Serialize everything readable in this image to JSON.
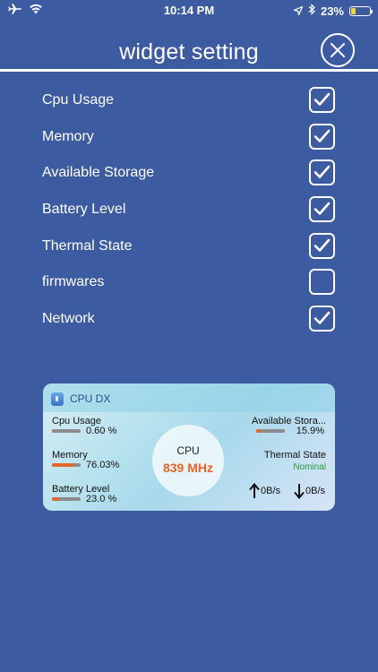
{
  "status_bar": {
    "time": "10:14 PM",
    "battery_text": "23%",
    "battery_level": 0.23,
    "battery_color": "#f5d33a"
  },
  "header": {
    "title": "widget setting"
  },
  "settings": [
    {
      "label": "Cpu Usage",
      "checked": true
    },
    {
      "label": "Memory",
      "checked": true
    },
    {
      "label": "Available Storage",
      "checked": true
    },
    {
      "label": "Battery Level",
      "checked": true
    },
    {
      "label": "Thermal State",
      "checked": true
    },
    {
      "label": "firmwares",
      "checked": false
    },
    {
      "label": "Network",
      "checked": true
    }
  ],
  "widget": {
    "app_name": "CPU DX",
    "cpu_usage": {
      "label": "Cpu Usage",
      "value": "0.60 %",
      "fraction": 0.006
    },
    "memory": {
      "label": "Memory",
      "value": "76.03%",
      "fraction": 0.7603
    },
    "battery": {
      "label": "Battery Level",
      "value": "23.0 %",
      "fraction": 0.23
    },
    "storage": {
      "label": "Available Stora...",
      "value": "15.9%",
      "fraction": 0.159
    },
    "thermal": {
      "label": "Thermal State",
      "value": "Nominal"
    },
    "cpu": {
      "label": "CPU",
      "frequency": "839 MHz"
    },
    "network": {
      "upload": "0B/s",
      "download": "0B/s"
    }
  },
  "colors": {
    "background": "#3d5ba0",
    "accent_orange": "#e8662a",
    "thermal_green": "#2e9a3c"
  },
  "icons": {
    "airplane": "airplane-mode-icon",
    "wifi": "wifi-icon",
    "location": "location-arrow-icon",
    "bluetooth": "bluetooth-icon",
    "battery": "battery-icon",
    "close": "close-icon",
    "check": "check-icon",
    "upload": "arrow-up-icon",
    "download": "arrow-down-icon"
  }
}
